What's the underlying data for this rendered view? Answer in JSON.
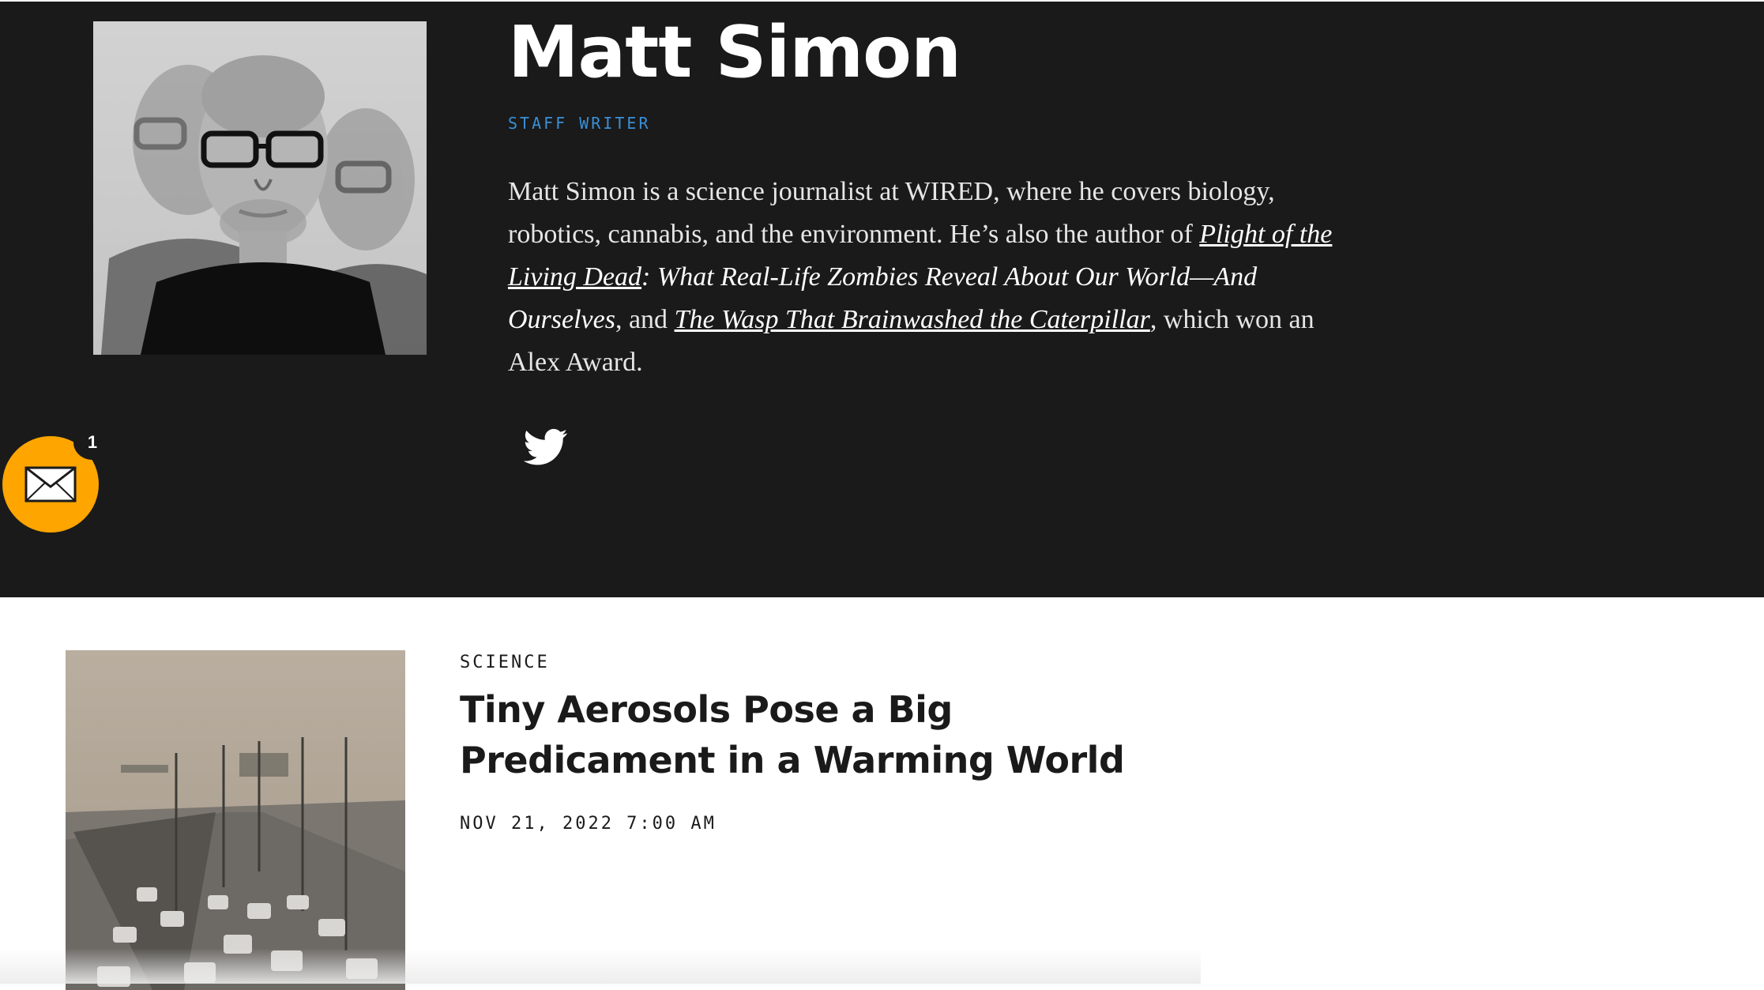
{
  "author": {
    "name": "Matt Simon",
    "role": "STAFF WRITER",
    "bio": {
      "intro": "Matt Simon is a science journalist at WIRED, where he covers biology, robotics, cannabis, and the environment. He’s also the author of ",
      "book1_link": "Plight of the Living Dead",
      "book1_subtitle": ": What Real-Life Zombies Reveal About Our World—And Ourselves",
      "and": ", and ",
      "book2_link": "The Wasp That Brainwashed the Caterpillar",
      "outro": ", which won an Alex Award."
    },
    "social": {
      "twitter_icon": "twitter-icon"
    }
  },
  "newsletter": {
    "icon": "envelope-icon",
    "badge_count": "1",
    "color": "#ffa500"
  },
  "story": {
    "category": "SCIENCE",
    "title": "Tiny Aerosols Pose a Big Predicament in a Warming World",
    "date": "NOV 21, 2022 7:00 AM"
  },
  "colors": {
    "hero_background": "#1a1a1a",
    "role_accent": "#3a8fd6"
  }
}
